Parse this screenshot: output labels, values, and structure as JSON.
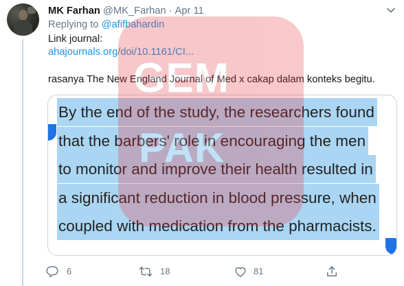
{
  "tweet": {
    "author_name": "MK Farhan",
    "author_handle": "@MK_Farhan",
    "separator": "·",
    "date": "Apr 11",
    "replying_prefix": "Replying to",
    "replying_to": "@afifbahardin",
    "link_label": "Link journal:",
    "link": "ahajournals.org/doi/10.1161/CI...",
    "body": "rasanya The New England Journal of Med x cakap dalam konteks begitu."
  },
  "media": {
    "lines": [
      "By the end of the study, the researchers found",
      "that the barbers' role in encouraging the men",
      "to monitor and improve their health resulted in",
      "a significant reduction in blood pressure, when",
      "coupled with medication from the pharmacists."
    ]
  },
  "actions": {
    "reply_icon": "reply-icon",
    "reply_count": "6",
    "retweet_icon": "retweet-icon",
    "retweet_count": "18",
    "like_icon": "heart-icon",
    "like_count": "81",
    "share_icon": "share-icon"
  },
  "watermark": {
    "line1": "GEM",
    "line2": "PAK"
  },
  "colors": {
    "text": "#14171a",
    "muted": "#657786",
    "link": "#1b95e0",
    "highlight": "#aad6f3",
    "selection_handle": "#1e74e6",
    "watermark": "#e8343f"
  }
}
